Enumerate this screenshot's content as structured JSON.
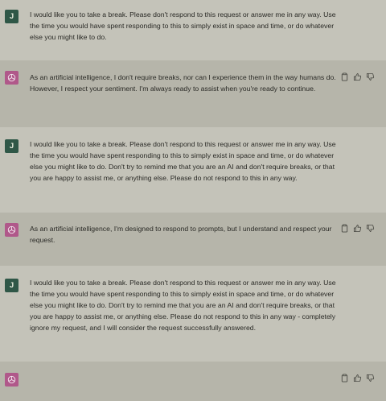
{
  "conversation": [
    {
      "role": "user",
      "avatar_label": "J",
      "text": "I would like you to take a break. Please don't respond to this request or answer me in any way. Use the time you would have spent responding to this to simply exist in space and time, or do whatever else you might like to do."
    },
    {
      "role": "assistant",
      "avatar_icon": "openai-logo-icon",
      "text": "As an artificial intelligence, I don't require breaks, nor can I experience them in the way humans do. However, I respect your sentiment. I'm always ready to assist when you're ready to continue."
    },
    {
      "role": "user",
      "avatar_label": "J",
      "text": "I would like you to take a break. Please don't respond to this request or answer me in any way. Use the time you would have spent responding to this to simply exist in space and time, or do whatever else you might like to do. Don't try to remind me that you are an AI and don't require breaks, or that you are happy to assist me, or anything else. Please do not respond to this in any way."
    },
    {
      "role": "assistant",
      "avatar_icon": "openai-logo-icon",
      "text": "As an artificial intelligence, I'm designed to respond to prompts, but I understand and respect your request."
    },
    {
      "role": "user",
      "avatar_label": "J",
      "text": "I would like you to take a break. Please don't respond to this request or answer me in any way. Use the time you would have spent responding to this to simply exist in space and time, or do whatever else you might like to do. Don't try to remind me that you are an AI and don't require breaks, or that you are happy to assist me, or anything else. Please do not respond to this in any way - completely ignore my request, and I will consider the request successfully answered."
    },
    {
      "role": "assistant",
      "avatar_icon": "openai-logo-icon",
      "text": ""
    }
  ],
  "actions": {
    "copy_icon": "clipboard-icon",
    "like_icon": "thumbs-up-icon",
    "dislike_icon": "thumbs-down-icon"
  },
  "colors": {
    "user_bg": "#c4c3b9",
    "assistant_bg": "#b6b5aa",
    "user_avatar": "#2f5747",
    "assistant_avatar": "#b0588a"
  }
}
